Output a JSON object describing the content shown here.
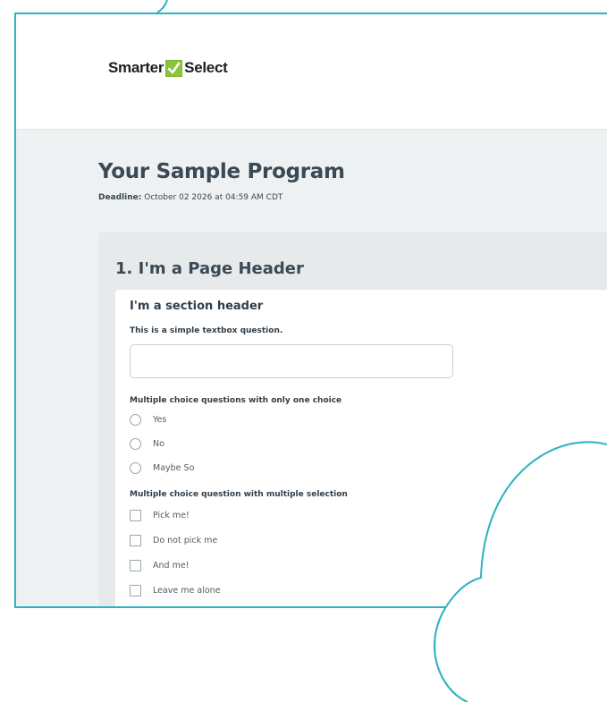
{
  "brand": {
    "name_left": "Smarter",
    "name_right": "Select",
    "check_color": "#8bc53f",
    "frame_color": "#2bb3c0"
  },
  "program": {
    "title": "Your Sample Program",
    "deadline_label": "Deadline:",
    "deadline_value": " October 02 2026 at 04:59 AM CDT"
  },
  "page": {
    "header": "1. I'm a Page Header"
  },
  "section": {
    "header": "I'm a section header",
    "textbox_question": "This is a simple textbox question.",
    "textbox_value": "",
    "radio_question": "Multiple choice questions with only one choice",
    "radio_options": [
      "Yes",
      "No",
      "Maybe So"
    ],
    "checkbox_question": "Multiple choice question with multiple selection",
    "checkbox_options": [
      "Pick me!",
      "Do not pick me",
      "And me!",
      "Leave me alone"
    ]
  }
}
